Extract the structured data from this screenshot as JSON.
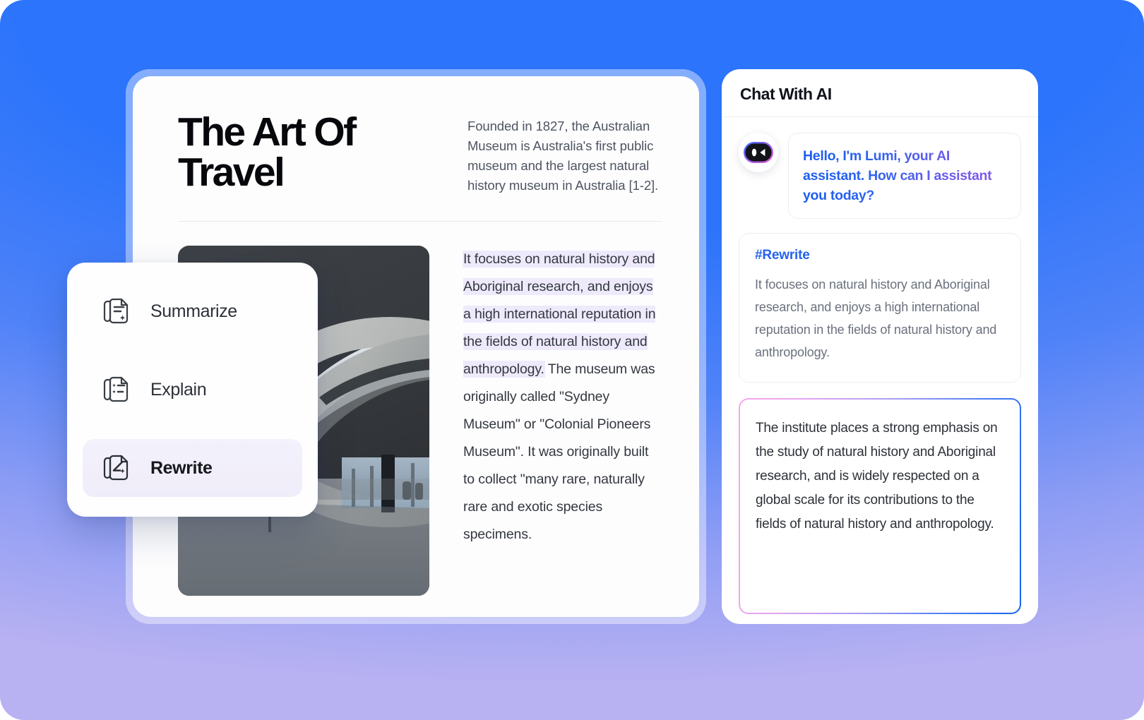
{
  "background": {
    "top_color": "#2b74fb",
    "bottom_color": "#bdb4f3"
  },
  "document": {
    "title": "The Art  Of Travel",
    "lead": "Founded in 1827, the Australian Museum is Australia's first public museum and the largest natural history museum in Australia [1-2].",
    "photo_alt": "concrete-architecture-interior",
    "body_highlighted": "It focuses on natural history and Aboriginal research, and enjoys a high international reputation in the fields of natural history and anthropology.",
    "body_rest": " The museum was originally called \"Sydney Museum\" or \"Colonial Pioneers Museum\". It was originally built to collect \"many rare, naturally rare and exotic species specimens.",
    "highlight_color": "#eeeafc"
  },
  "action_menu": {
    "items": [
      {
        "label": "Summarize",
        "icon": "doc-lines-sparkle-icon",
        "active": false
      },
      {
        "label": "Explain",
        "icon": "doc-bullets-icon",
        "active": false
      },
      {
        "label": "Rewrite",
        "icon": "doc-pen-sparkle-icon",
        "active": true
      }
    ]
  },
  "chat": {
    "title": "Chat With AI",
    "avatar_icon": "lumi-robot-avatar-icon",
    "greeting": "Hello, I'm Lumi, your AI assistant. How can I assistant you today?",
    "greeting_gradient": [
      "#1a5df0",
      "#8a57e8"
    ],
    "rewrite_tag": "#Rewrite",
    "rewrite_tag_color": "#2563f0",
    "rewrite_source": "It focuses on natural history and Aboriginal research, and enjoys a high international reputation in the fields of natural history and anthropology.",
    "result": "The institute places a strong emphasis on the study of natural history and Aboriginal research, and is widely respected on a global scale for its contributions to the fields of natural history and anthropology.",
    "result_border_gradient": [
      "#f8a8ec",
      "#1263f2"
    ]
  }
}
